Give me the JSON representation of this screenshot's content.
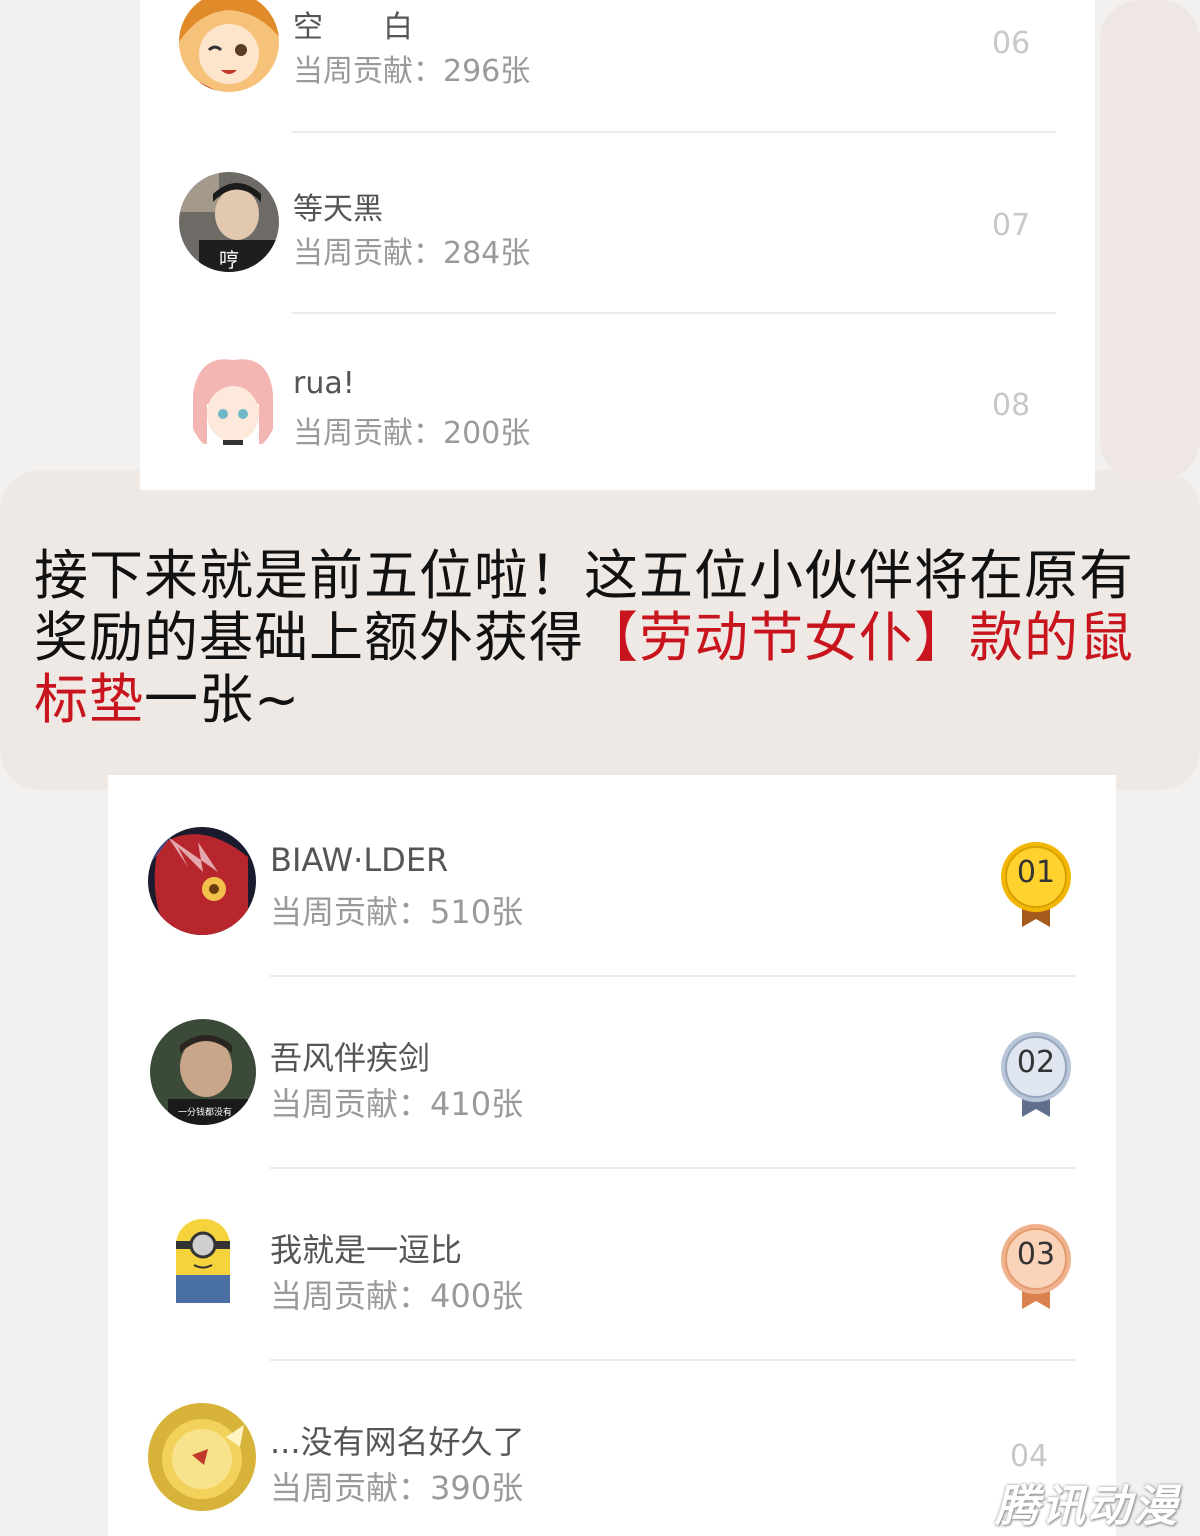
{
  "top_list": {
    "rows": [
      {
        "name": "空　　白",
        "contribution": "当周贡献：296张",
        "rank": "06",
        "avatar": "anime-girl-winking-avatar"
      },
      {
        "name": "等天黑",
        "contribution": "当周贡献：284张",
        "rank": "07",
        "avatar": "photo-man-avatar"
      },
      {
        "name": "rua!",
        "contribution": "当周贡献：200张",
        "rank": "08",
        "avatar": "pink-hair-girl-avatar"
      }
    ]
  },
  "avatar_captions": {
    "row_07": "哼",
    "bottom_row_02": "一分钱都没有"
  },
  "announcement": {
    "part1": "接下来就是前五位啦！这五位小伙伴将在原有奖励的基础上额外获得",
    "highlight": "【劳动节女仆】款的鼠标垫",
    "part2": "一张~"
  },
  "bottom_list": {
    "rows": [
      {
        "name": "BIAW·LDER",
        "contribution": "当周贡献：510张",
        "rank": "01",
        "medal": "gold"
      },
      {
        "name": "吾风伴疾剑",
        "contribution": "当周贡献：410张",
        "rank": "02",
        "medal": "silver"
      },
      {
        "name": "我就是一逗比",
        "contribution": "当周贡献：400张",
        "rank": "03",
        "medal": "bronze"
      },
      {
        "name": "...没有网名好久了",
        "contribution": "当周贡献：390张",
        "rank": "04",
        "medal": "none"
      }
    ]
  },
  "colors": {
    "gold": "#f2b705",
    "silver": "#b9c6d8",
    "bronze": "#f0b38f",
    "highlight": "#c8141c"
  },
  "watermark": "腾讯动漫"
}
